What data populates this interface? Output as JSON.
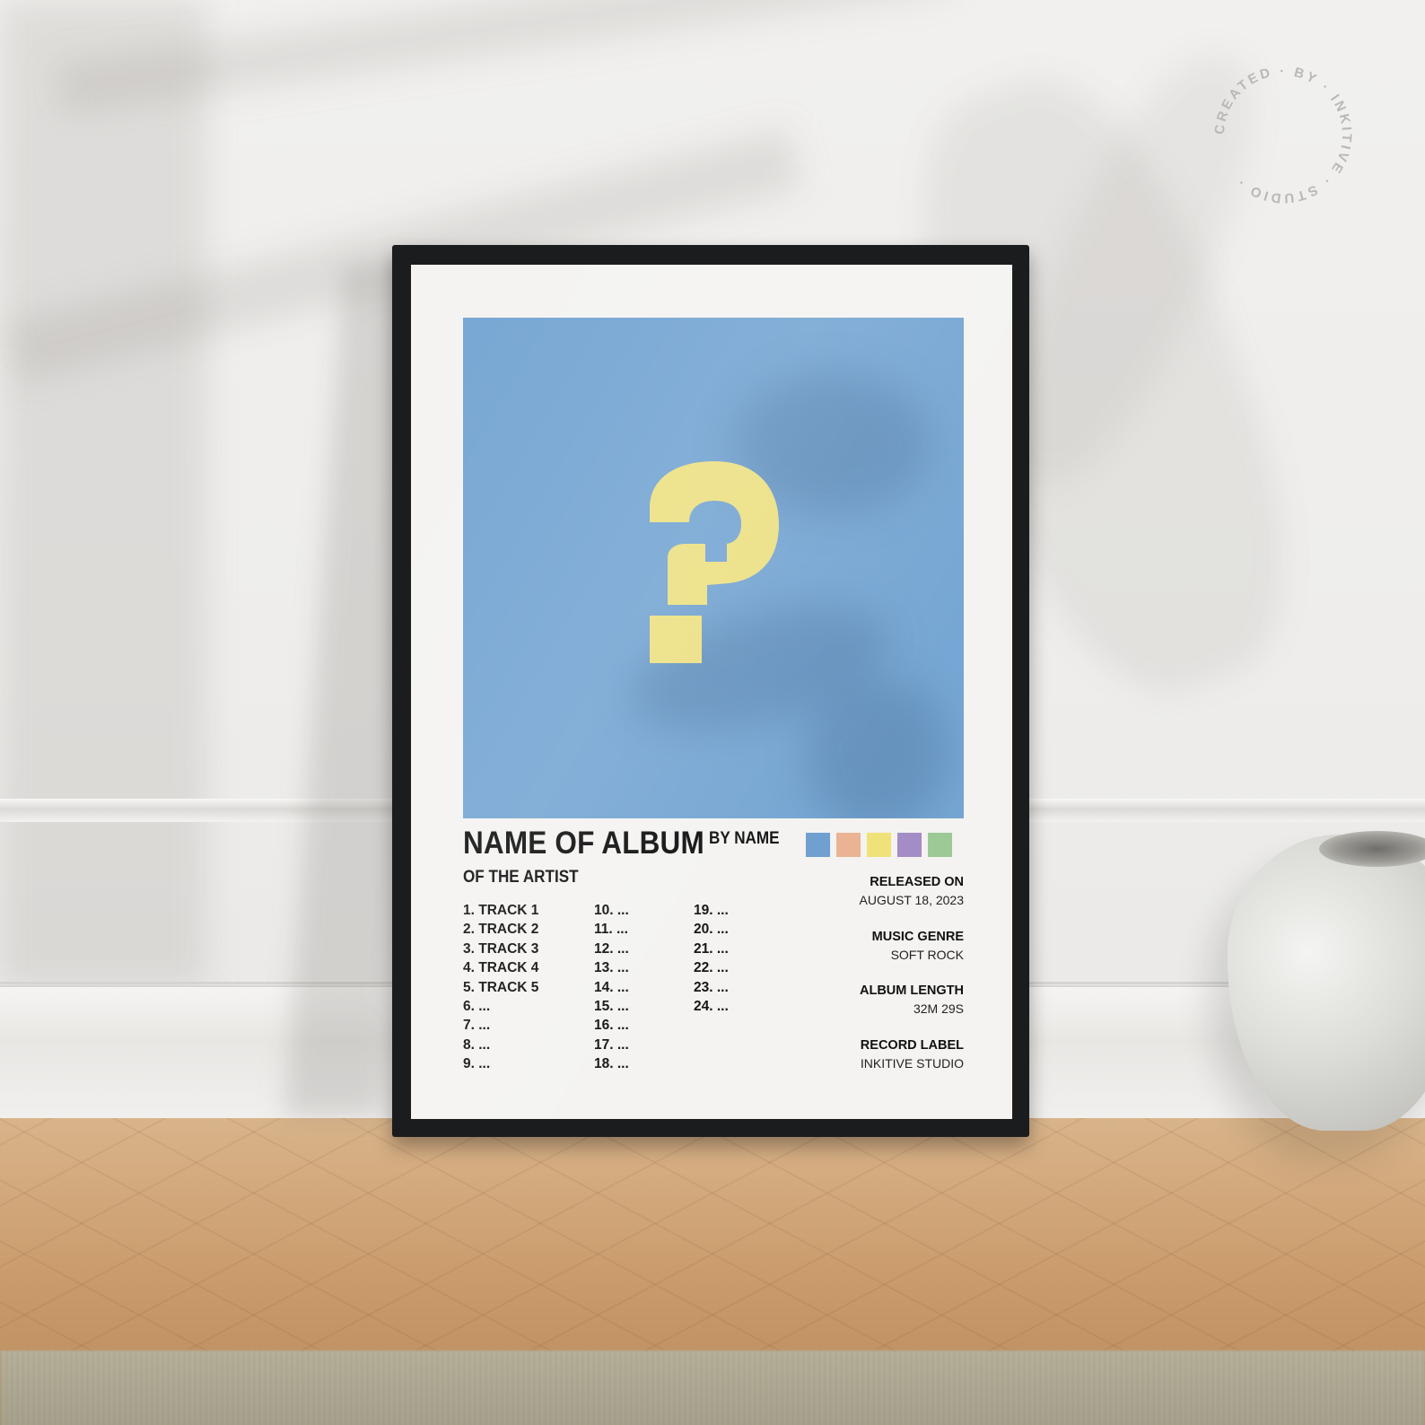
{
  "badge": {
    "text": "CREATED · BY · INKITIVE · STUDIO · "
  },
  "poster": {
    "album_title": "NAME OF ALBUM",
    "by_name": "BY NAME",
    "subtitle": "OF THE ARTIST",
    "cover_color": "#76a6d3",
    "question_mark_color": "#ece084",
    "palette": [
      "#6f9fd0",
      "#eab394",
      "#efe279",
      "#a48cc7",
      "#9cc996"
    ],
    "tracks_col1": [
      "1. TRACK 1",
      "2. TRACK 2",
      "3. TRACK 3",
      "4. TRACK 4",
      "5. TRACK 5",
      "6. ...",
      "7. ...",
      "8. ...",
      "9. ..."
    ],
    "tracks_col2": [
      "10. ...",
      "11. ...",
      "12. ...",
      "13. ...",
      "14. ...",
      "15. ...",
      "16. ...",
      "17. ...",
      "18. ..."
    ],
    "tracks_col3": [
      "19. ...",
      "20. ...",
      "21. ...",
      "22. ...",
      "23. ...",
      "24. ..."
    ],
    "info": [
      {
        "label": "RELEASED ON",
        "value": "AUGUST 18, 2023"
      },
      {
        "label": "MUSIC GENRE",
        "value": "SOFT ROCK"
      },
      {
        "label": "ALBUM LENGTH",
        "value": "32M 29S"
      },
      {
        "label": "RECORD LABEL",
        "value": "INKITIVE STUDIO"
      }
    ]
  }
}
